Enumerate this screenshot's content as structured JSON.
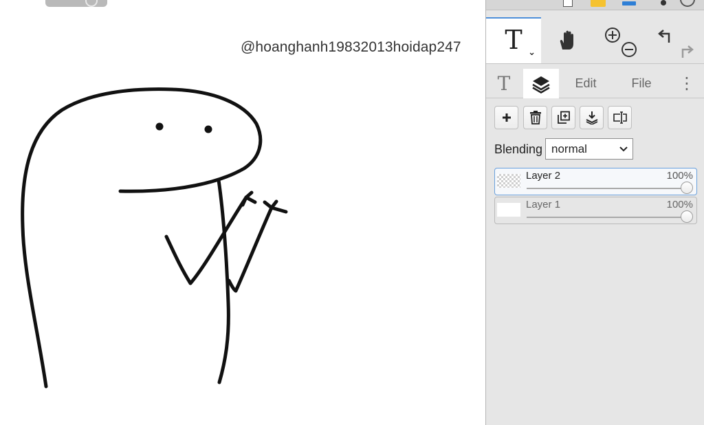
{
  "canvas": {
    "watermark": "@hoanghanh19832013hoidap247"
  },
  "toolbar": {
    "active_tool": "text",
    "tools": [
      {
        "name": "text",
        "icon": "text-tool-icon",
        "glyph": "T",
        "dropdown_glyph": "⌄"
      },
      {
        "name": "pan",
        "icon": "hand-icon"
      },
      {
        "name": "zoom",
        "icon": "zoom-in-out-icon"
      },
      {
        "name": "history",
        "icon": "undo-redo-icon"
      }
    ]
  },
  "tabs": {
    "text_glyph": "T",
    "edit": "Edit",
    "file": "File",
    "more_glyph": "⋮",
    "active": "layers"
  },
  "blending": {
    "label": "Blending",
    "value": "normal"
  },
  "layers": [
    {
      "name": "Layer 2",
      "opacity_label": "100%",
      "opacity": 1.0,
      "selected": true
    },
    {
      "name": "Layer 1",
      "opacity_label": "100%",
      "opacity": 1.0,
      "selected": false
    }
  ],
  "colors": {
    "accent": "#4e8fd9",
    "panel_bg": "#e6e6e6",
    "stroke": "#111111"
  }
}
